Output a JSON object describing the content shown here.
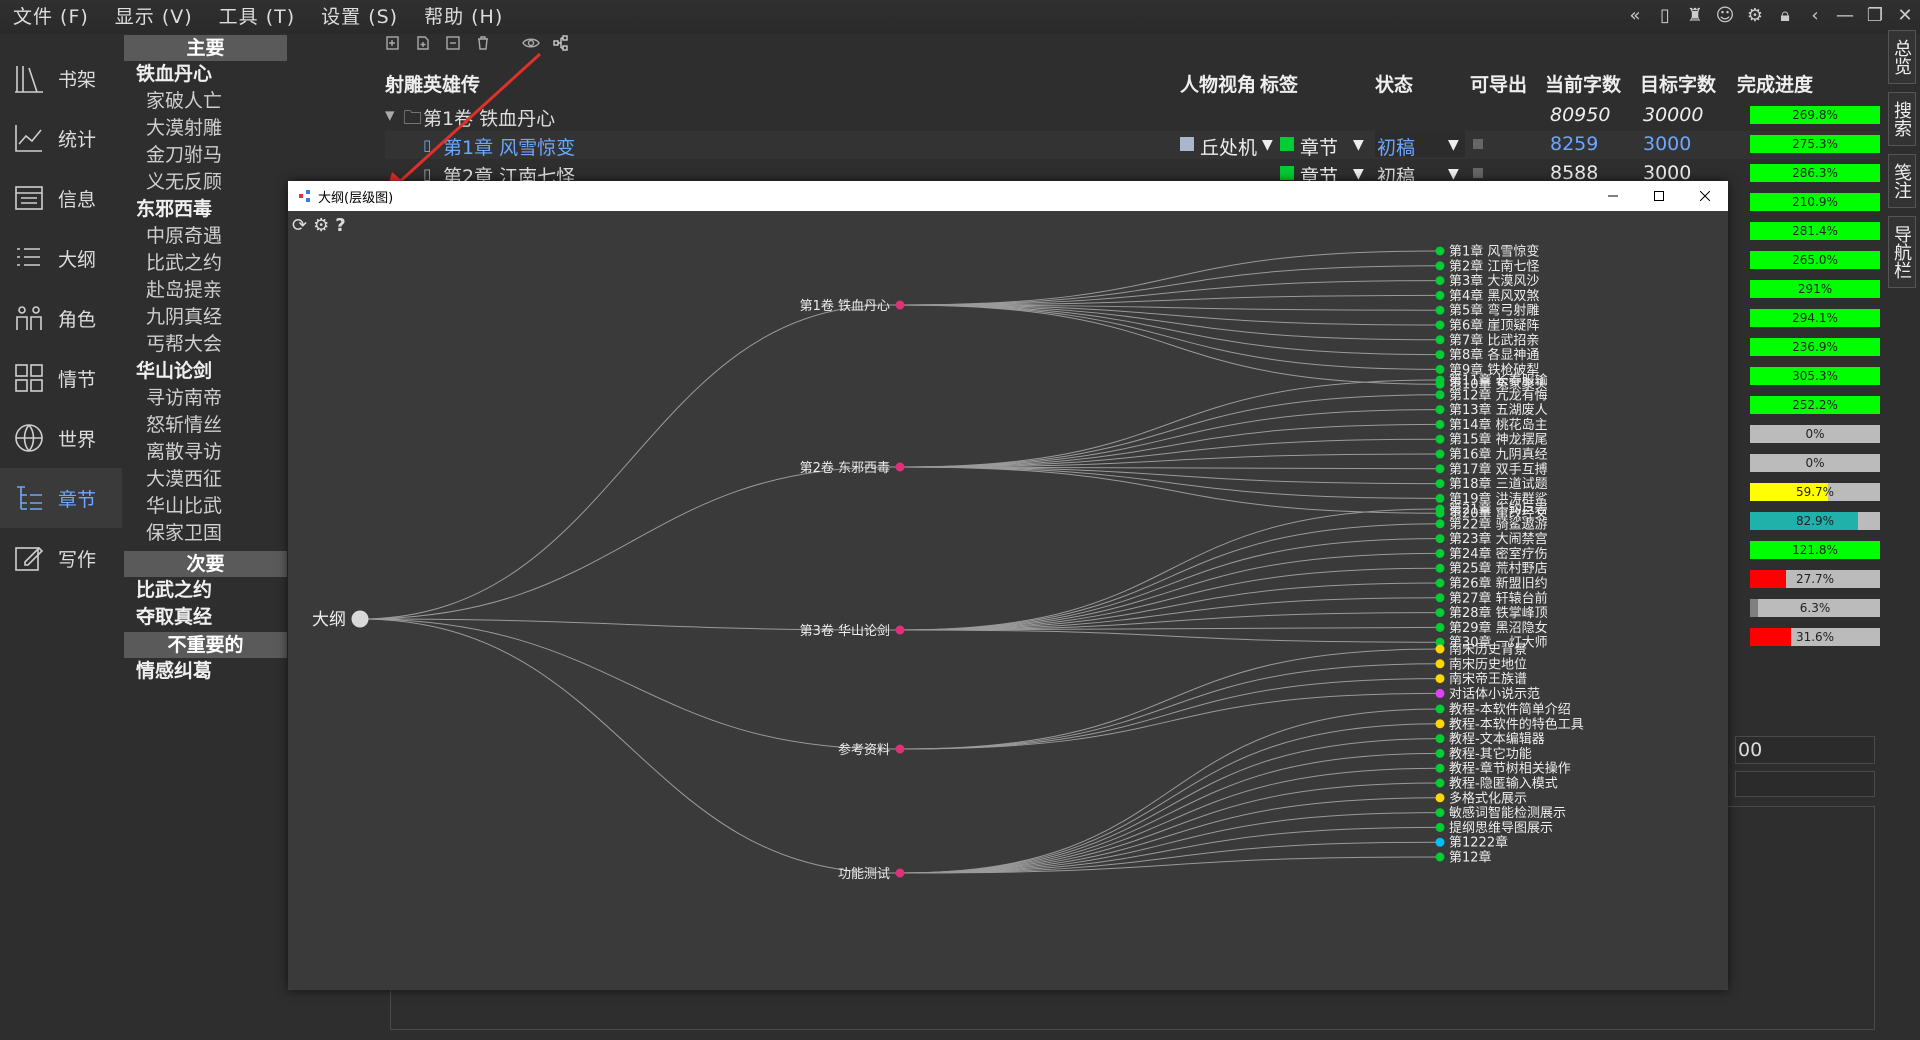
{
  "menu": [
    "文件 (F)",
    "显示 (V)",
    "工具 (T)",
    "设置 (S)",
    "帮助 (H)"
  ],
  "nav": [
    "书架",
    "统计",
    "信息",
    "大纲",
    "角色",
    "情节",
    "世界",
    "章节",
    "写作"
  ],
  "nav_icons": [
    "bookshelf-icon",
    "chart-icon",
    "info-icon",
    "outline-icon",
    "people-icon",
    "plot-icon",
    "globe-icon",
    "chapter-icon",
    "write-icon"
  ],
  "tree": {
    "main": "主要",
    "secondary": "次要",
    "unimportant": "不重要的",
    "main_items": [
      {
        "vol": "铁血丹心",
        "chs": [
          "家破人亡",
          "大漠射雕",
          "金刀驸马",
          "义无反顾"
        ]
      },
      {
        "vol": "东邪西毒",
        "chs": [
          "中原奇遇",
          "比武之约",
          "赴岛提亲",
          "九阴真经",
          "丐帮大会"
        ]
      },
      {
        "vol": "华山论剑",
        "chs": [
          "寻访南帝",
          "怒斩情丝",
          "离散寻访",
          "大漠西征",
          "华山比武",
          "保家卫国"
        ]
      }
    ],
    "secondary_items": [
      "比武之约",
      "夺取真经"
    ],
    "unimportant_items": [
      "情感纠葛"
    ]
  },
  "grid": {
    "book": "射雕英雄传",
    "cols": [
      "人物视角",
      "标签",
      "状态",
      "可导出",
      "当前字数",
      "目标字数",
      "完成进度"
    ],
    "rows": [
      {
        "name": "第1卷 铁血丹心",
        "current": "80950",
        "target": "30000"
      },
      {
        "name": "第1章 风雪惊变",
        "pov": "丘处机",
        "tag": "章节",
        "status": "初稿",
        "current": "8259",
        "target": "3000"
      },
      {
        "name": "第2章 江南七怪",
        "tag": "章节",
        "status": "初稿",
        "current": "8588",
        "target": "3000"
      }
    ],
    "partial_text": "00"
  },
  "progress": [
    {
      "text": "269.8%",
      "value": 1.0,
      "color": "#00ff00"
    },
    {
      "text": "275.3%",
      "value": 1.0,
      "color": "#00ff00"
    },
    {
      "text": "286.3%",
      "value": 1.0,
      "color": "#00ff00"
    },
    {
      "text": "210.9%",
      "value": 1.0,
      "color": "#00ff00"
    },
    {
      "text": "281.4%",
      "value": 1.0,
      "color": "#00ff00"
    },
    {
      "text": "265.0%",
      "value": 1.0,
      "color": "#00ff00"
    },
    {
      "text": "291%",
      "value": 1.0,
      "color": "#00ff00"
    },
    {
      "text": "294.1%",
      "value": 1.0,
      "color": "#00ff00"
    },
    {
      "text": "236.9%",
      "value": 1.0,
      "color": "#00ff00"
    },
    {
      "text": "305.3%",
      "value": 1.0,
      "color": "#00ff00"
    },
    {
      "text": "252.2%",
      "value": 1.0,
      "color": "#00ff00"
    },
    {
      "text": "0%",
      "value": 0.0,
      "color": "#00ff00"
    },
    {
      "text": "0%",
      "value": 0.0,
      "color": "#00ff00"
    },
    {
      "text": "59.7%",
      "value": 0.597,
      "color": "#ffff00"
    },
    {
      "text": "82.9%",
      "value": 0.829,
      "color": "#20b2aa"
    },
    {
      "text": "121.8%",
      "value": 1.0,
      "color": "#00ff00"
    },
    {
      "text": "27.7%",
      "value": 0.277,
      "color": "#ff0000"
    },
    {
      "text": "6.3%",
      "value": 0.063,
      "color": "#808080"
    },
    {
      "text": "31.6%",
      "value": 0.316,
      "color": "#ff0000"
    }
  ],
  "right_tabs": [
    "总览",
    "搜索",
    "笺注",
    "导航栏"
  ],
  "window": {
    "title": "大纲(层级图)"
  },
  "mindmap": {
    "root": "大纲",
    "branches": [
      {
        "label": "第1卷 铁血丹心",
        "leaves": [
          {
            "t": "第1章 风雪惊变",
            "c": "#00cc33"
          },
          {
            "t": "第2章 江南七怪",
            "c": "#00cc33"
          },
          {
            "t": "第3章 大漠风沙",
            "c": "#00cc33"
          },
          {
            "t": "第4章 黑风双煞",
            "c": "#00cc33"
          },
          {
            "t": "第5章 弯弓射雕",
            "c": "#00cc33"
          },
          {
            "t": "第6章 崖顶疑阵",
            "c": "#00cc33"
          },
          {
            "t": "第7章 比武招亲",
            "c": "#00cc33"
          },
          {
            "t": "第8章 各显神通",
            "c": "#00cc33"
          },
          {
            "t": "第9章 铁枪破犁",
            "c": "#00cc33"
          },
          {
            "t": "第10章 冤家聚头",
            "c": "#00cc33"
          }
        ]
      },
      {
        "label": "第2卷 东邪西毒",
        "leaves": [
          {
            "t": "第11章 长春服输",
            "c": "#00cc33"
          },
          {
            "t": "第12章 亢龙有悔",
            "c": "#00cc33"
          },
          {
            "t": "第13章 五湖废人",
            "c": "#00cc33"
          },
          {
            "t": "第14章 桃花岛主",
            "c": "#00cc33"
          },
          {
            "t": "第15章 神龙摆尾",
            "c": "#00cc33"
          },
          {
            "t": "第16章 九阴真经",
            "c": "#00cc33"
          },
          {
            "t": "第17章 双手互搏",
            "c": "#00cc33"
          },
          {
            "t": "第18章 三道试题",
            "c": "#00cc33"
          },
          {
            "t": "第19章 洪涛群鲨",
            "c": "#00cc33"
          },
          {
            "t": "第20章 窜改经文",
            "c": "#00cc33"
          }
        ]
      },
      {
        "label": "第3卷 华山论剑",
        "leaves": [
          {
            "t": "第21章 千钧巨岩",
            "c": "#00cc33"
          },
          {
            "t": "第22章 骑鲨遨游",
            "c": "#00cc33"
          },
          {
            "t": "第23章 大闹禁宫",
            "c": "#00cc33"
          },
          {
            "t": "第24章 密室疗伤",
            "c": "#00cc33"
          },
          {
            "t": "第25章 荒村野店",
            "c": "#00cc33"
          },
          {
            "t": "第26章 新盟旧约",
            "c": "#00cc33"
          },
          {
            "t": "第27章 轩辕台前",
            "c": "#00cc33"
          },
          {
            "t": "第28章 铁掌峰顶",
            "c": "#00cc33"
          },
          {
            "t": "第29章 黑沼隐女",
            "c": "#00cc33"
          },
          {
            "t": "第30章 一灯大师",
            "c": "#00cc33"
          }
        ]
      },
      {
        "label": "参考资料",
        "leaves": [
          {
            "t": "南宋历史背景",
            "c": "#ffd700"
          },
          {
            "t": "南宋历史地位",
            "c": "#ffd700"
          },
          {
            "t": "南宋帝王族谱",
            "c": "#ffd700"
          },
          {
            "t": "对话体小说示范",
            "c": "#e040fb"
          }
        ]
      },
      {
        "label": "功能测试",
        "leaves": [
          {
            "t": "教程-本软件简单介绍",
            "c": "#00cc33"
          },
          {
            "t": "教程-本软件的特色工具",
            "c": "#ffd700"
          },
          {
            "t": "教程-文本编辑器",
            "c": "#00cc33"
          },
          {
            "t": "教程-其它功能",
            "c": "#00cc33"
          },
          {
            "t": "教程-章节树相关操作",
            "c": "#00cc33"
          },
          {
            "t": "教程-隐匿输入模式",
            "c": "#00cc33"
          },
          {
            "t": "多格式化展示",
            "c": "#ffd700"
          },
          {
            "t": "敏感词智能检测展示",
            "c": "#00cc33"
          },
          {
            "t": "提纲思维导图展示",
            "c": "#00cc33"
          },
          {
            "t": "第1222章",
            "c": "#00bfff"
          },
          {
            "t": "第12章",
            "c": "#00cc33"
          }
        ]
      }
    ]
  }
}
